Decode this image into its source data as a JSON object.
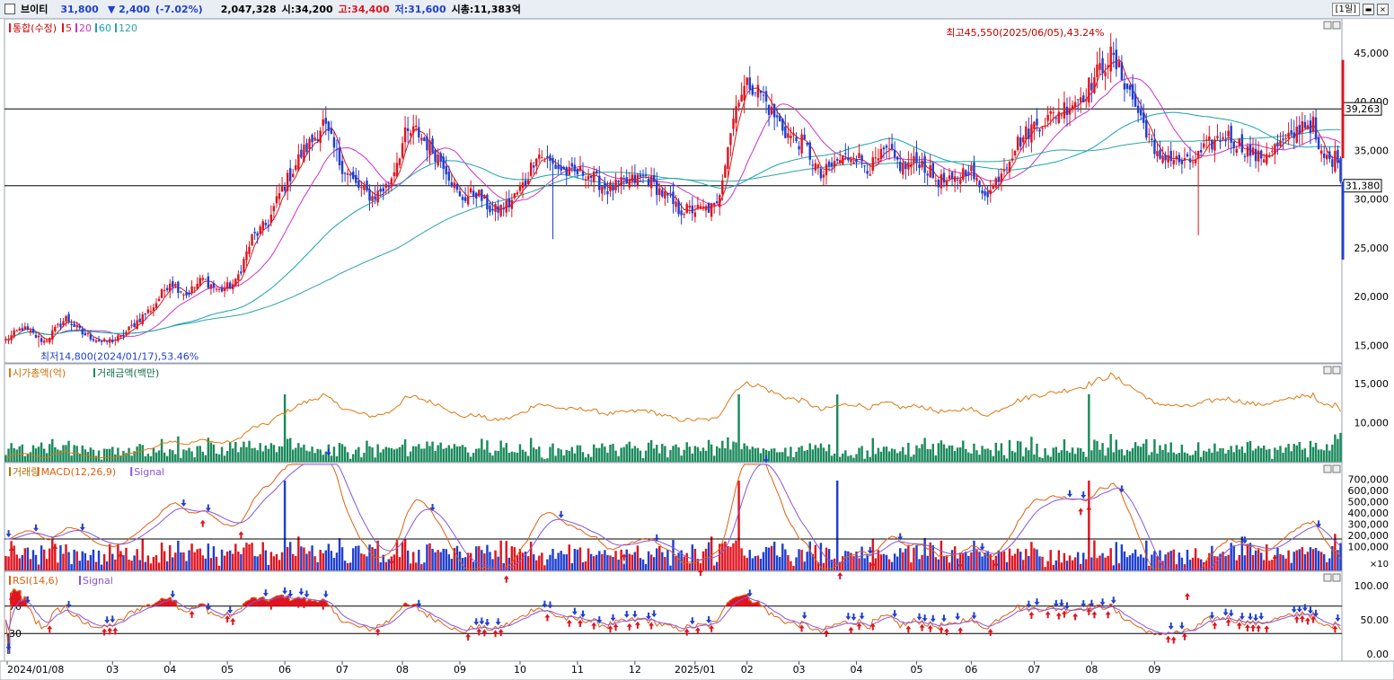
{
  "header": {
    "stock_name": "브이티",
    "price": "31,800",
    "change": "▼ 2,400",
    "change_pct": "(-7.02%)",
    "volume": "2,047,328",
    "open_label": "시:",
    "open": "34,200",
    "high_label": "고:",
    "high": "34,400",
    "low_label": "저:",
    "low": "31,600",
    "mcap_label": "시총:",
    "mcap": "11,383억",
    "period": "[1일]"
  },
  "colors": {
    "up": "#e0141e",
    "down": "#1f3fd0",
    "ma5": "#e0141e",
    "ma20": "#cc33cc",
    "ma60": "#17a2b8",
    "ma120": "#2aa6a0",
    "macd": "#e06010",
    "signal": "#8855dd",
    "trade_value": "#1a8a5a",
    "market_cap": "#e07810"
  },
  "chart_data": [
    {
      "type": "candlestick",
      "title": "통합(수정)",
      "legend": [
        "5",
        "20",
        "60",
        "120"
      ],
      "x_ticks": [
        "2024/01/08",
        "03",
        "04",
        "05",
        "06",
        "07",
        "08",
        "09",
        "10",
        "11",
        "12",
        "2025/01",
        "02",
        "03",
        "04",
        "05",
        "06",
        "07",
        "08",
        "09"
      ],
      "y_ticks": [
        "45,000",
        "40,000",
        "35,000",
        "30,000",
        "25,000",
        "20,000",
        "15,000"
      ],
      "ylim": [
        13200,
        48500
      ],
      "hlines": [
        39263,
        31380
      ],
      "hline_labels": [
        "39,263",
        "31,380"
      ],
      "annotation_high": "최고45,550(2025/06/05),43.24%",
      "annotation_low": "최저14,800(2024/01/17),53.46%",
      "anchors": [
        [
          0,
          15500
        ],
        [
          6,
          16800
        ],
        [
          14,
          15400
        ],
        [
          22,
          17800
        ],
        [
          28,
          16200
        ],
        [
          36,
          15300
        ],
        [
          42,
          15800
        ],
        [
          48,
          17500
        ],
        [
          54,
          19000
        ],
        [
          60,
          21600
        ],
        [
          66,
          20200
        ],
        [
          72,
          21800
        ],
        [
          78,
          20600
        ],
        [
          84,
          21400
        ],
        [
          90,
          26000
        ],
        [
          96,
          27600
        ],
        [
          100,
          30500
        ],
        [
          104,
          32500
        ],
        [
          108,
          34600
        ],
        [
          112,
          36000
        ],
        [
          116,
          37800
        ],
        [
          122,
          33800
        ],
        [
          128,
          31400
        ],
        [
          134,
          30200
        ],
        [
          140,
          31500
        ],
        [
          146,
          36500
        ],
        [
          150,
          37000
        ],
        [
          156,
          35000
        ],
        [
          160,
          33800
        ],
        [
          166,
          30000
        ],
        [
          172,
          30700
        ],
        [
          178,
          28700
        ],
        [
          184,
          29500
        ],
        [
          190,
          31800
        ],
        [
          194,
          34800
        ],
        [
          200,
          33500
        ],
        [
          206,
          32600
        ],
        [
          212,
          32800
        ],
        [
          220,
          31000
        ],
        [
          228,
          31800
        ],
        [
          234,
          32300
        ],
        [
          240,
          30600
        ],
        [
          246,
          28900
        ],
        [
          254,
          28900
        ],
        [
          260,
          29200
        ],
        [
          264,
          35800
        ],
        [
          268,
          40800
        ],
        [
          272,
          41900
        ],
        [
          276,
          40900
        ],
        [
          280,
          38900
        ],
        [
          286,
          36600
        ],
        [
          292,
          35600
        ],
        [
          298,
          32300
        ],
        [
          304,
          33900
        ],
        [
          310,
          34600
        ],
        [
          316,
          33200
        ],
        [
          322,
          34900
        ],
        [
          328,
          33200
        ],
        [
          334,
          34000
        ],
        [
          340,
          32000
        ],
        [
          346,
          31600
        ],
        [
          352,
          33400
        ],
        [
          356,
          31000
        ],
        [
          360,
          30800
        ],
        [
          364,
          33000
        ],
        [
          370,
          35800
        ],
        [
          376,
          37600
        ],
        [
          382,
          38400
        ],
        [
          388,
          39600
        ],
        [
          394,
          40800
        ],
        [
          400,
          43300
        ],
        [
          404,
          44700
        ],
        [
          410,
          41600
        ],
        [
          414,
          38900
        ],
        [
          418,
          36600
        ],
        [
          420,
          34200
        ],
        [
          424,
          34600
        ],
        [
          428,
          33900
        ],
        [
          432,
          33600
        ],
        [
          436,
          34400
        ],
        [
          440,
          35600
        ],
        [
          446,
          36600
        ],
        [
          452,
          35400
        ],
        [
          458,
          34200
        ],
        [
          464,
          35300
        ],
        [
          470,
          36200
        ],
        [
          474,
          37800
        ],
        [
          478,
          37600
        ],
        [
          480,
          34600
        ],
        [
          484,
          34000
        ],
        [
          488,
          34400
        ]
      ]
    },
    {
      "type": "bar+line",
      "title": "시가총액(억) / 거래금액(백만)",
      "legend": [
        "시가총액(억)",
        "거래금액(백만)"
      ],
      "y_ticks": [
        "15,000",
        "10,000"
      ]
    },
    {
      "type": "bar+line",
      "title": "거래량 / MACD(12,26,9) / Signal",
      "legend": [
        "거래량",
        "MACD(12,26,9)",
        "Signal"
      ],
      "y_ticks": [
        "700,000",
        "600,000",
        "500,000",
        "400,000",
        "300,000",
        "200,000",
        "100,000"
      ],
      "corner_label": "×10"
    },
    {
      "type": "line",
      "title": "RSI(14,6) / Signal",
      "legend": [
        "RSI(14,6)",
        "Signal"
      ],
      "y_ticks": [
        "100.00",
        "50.00",
        "0.00"
      ],
      "ylim": [
        0,
        100
      ],
      "ref_labels": [
        "70",
        "30"
      ]
    }
  ]
}
